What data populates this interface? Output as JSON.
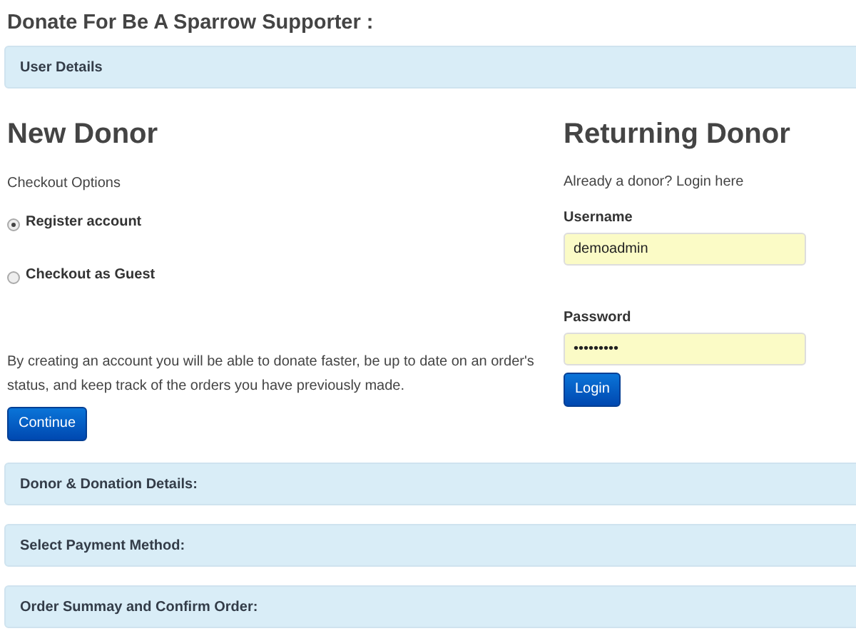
{
  "title": "Donate For Be A Sparrow Supporter :",
  "sections_top": [
    {
      "label": "User Details"
    }
  ],
  "new_donor": {
    "heading": "New Donor",
    "subheading": "Checkout Options",
    "options": [
      {
        "label": "Register account",
        "selected": true
      },
      {
        "label": "Checkout as Guest",
        "selected": false
      }
    ],
    "description": "By creating an account you will be able to donate faster, be up to date on an order's status, and keep track of the orders you have previously made.",
    "button": "Continue"
  },
  "returning_donor": {
    "heading": "Returning Donor",
    "subheading": "Already a donor? Login here",
    "fields": [
      {
        "label": "Username",
        "value": "demoadmin"
      },
      {
        "label": "Password",
        "value": "•••••••••"
      }
    ],
    "button": "Login"
  },
  "sections_bottom": [
    {
      "label": "Donor & Donation Details:"
    },
    {
      "label": "Select Payment Method:"
    },
    {
      "label": "Order Summay and Confirm Order:"
    }
  ]
}
